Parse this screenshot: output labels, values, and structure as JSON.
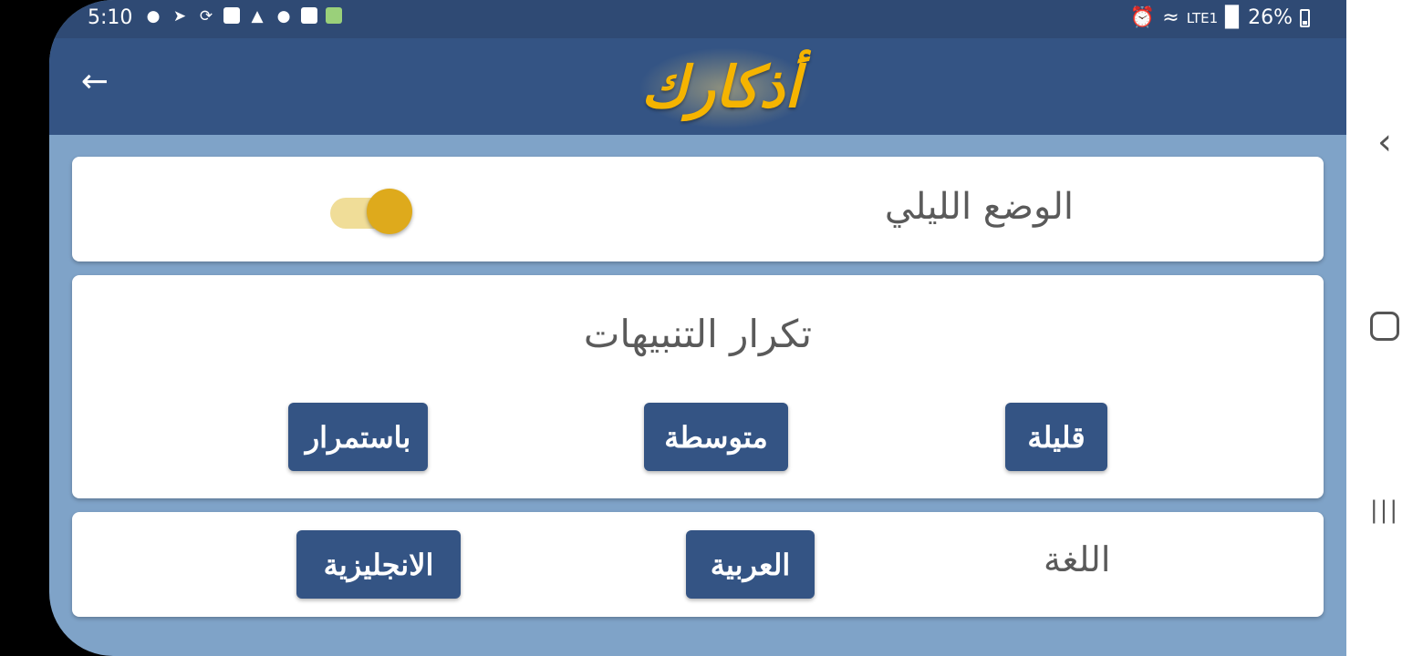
{
  "status_bar": {
    "time": "5:10",
    "left_icons": [
      "shopping-bag-icon",
      "telegram-icon",
      "sync-icon",
      "checkbox-icon",
      "warning-icon",
      "keyhole-icon",
      "image-icon",
      "app-icon"
    ],
    "battery": "26%",
    "network": "LTE1"
  },
  "app_bar": {
    "title": "أذكارك",
    "back_icon": "arrow-left-icon"
  },
  "night_mode": {
    "label": "الوضع الليلي",
    "enabled": true
  },
  "notifications": {
    "title": "تكرار التنبيهات",
    "options": [
      "قليلة",
      "متوسطة",
      "باستمرار"
    ]
  },
  "language": {
    "label": "اللغة",
    "options": [
      "العربية",
      "الانجليزية"
    ]
  },
  "colors": {
    "app_bar": "#345484",
    "background": "#7fa3c8",
    "button": "#345484",
    "accent": "#deaa1c",
    "title": "#f5b400"
  },
  "nav_bar": {
    "back": "chevron-left-icon",
    "home": "home-icon",
    "recent": "recent-apps-icon"
  }
}
